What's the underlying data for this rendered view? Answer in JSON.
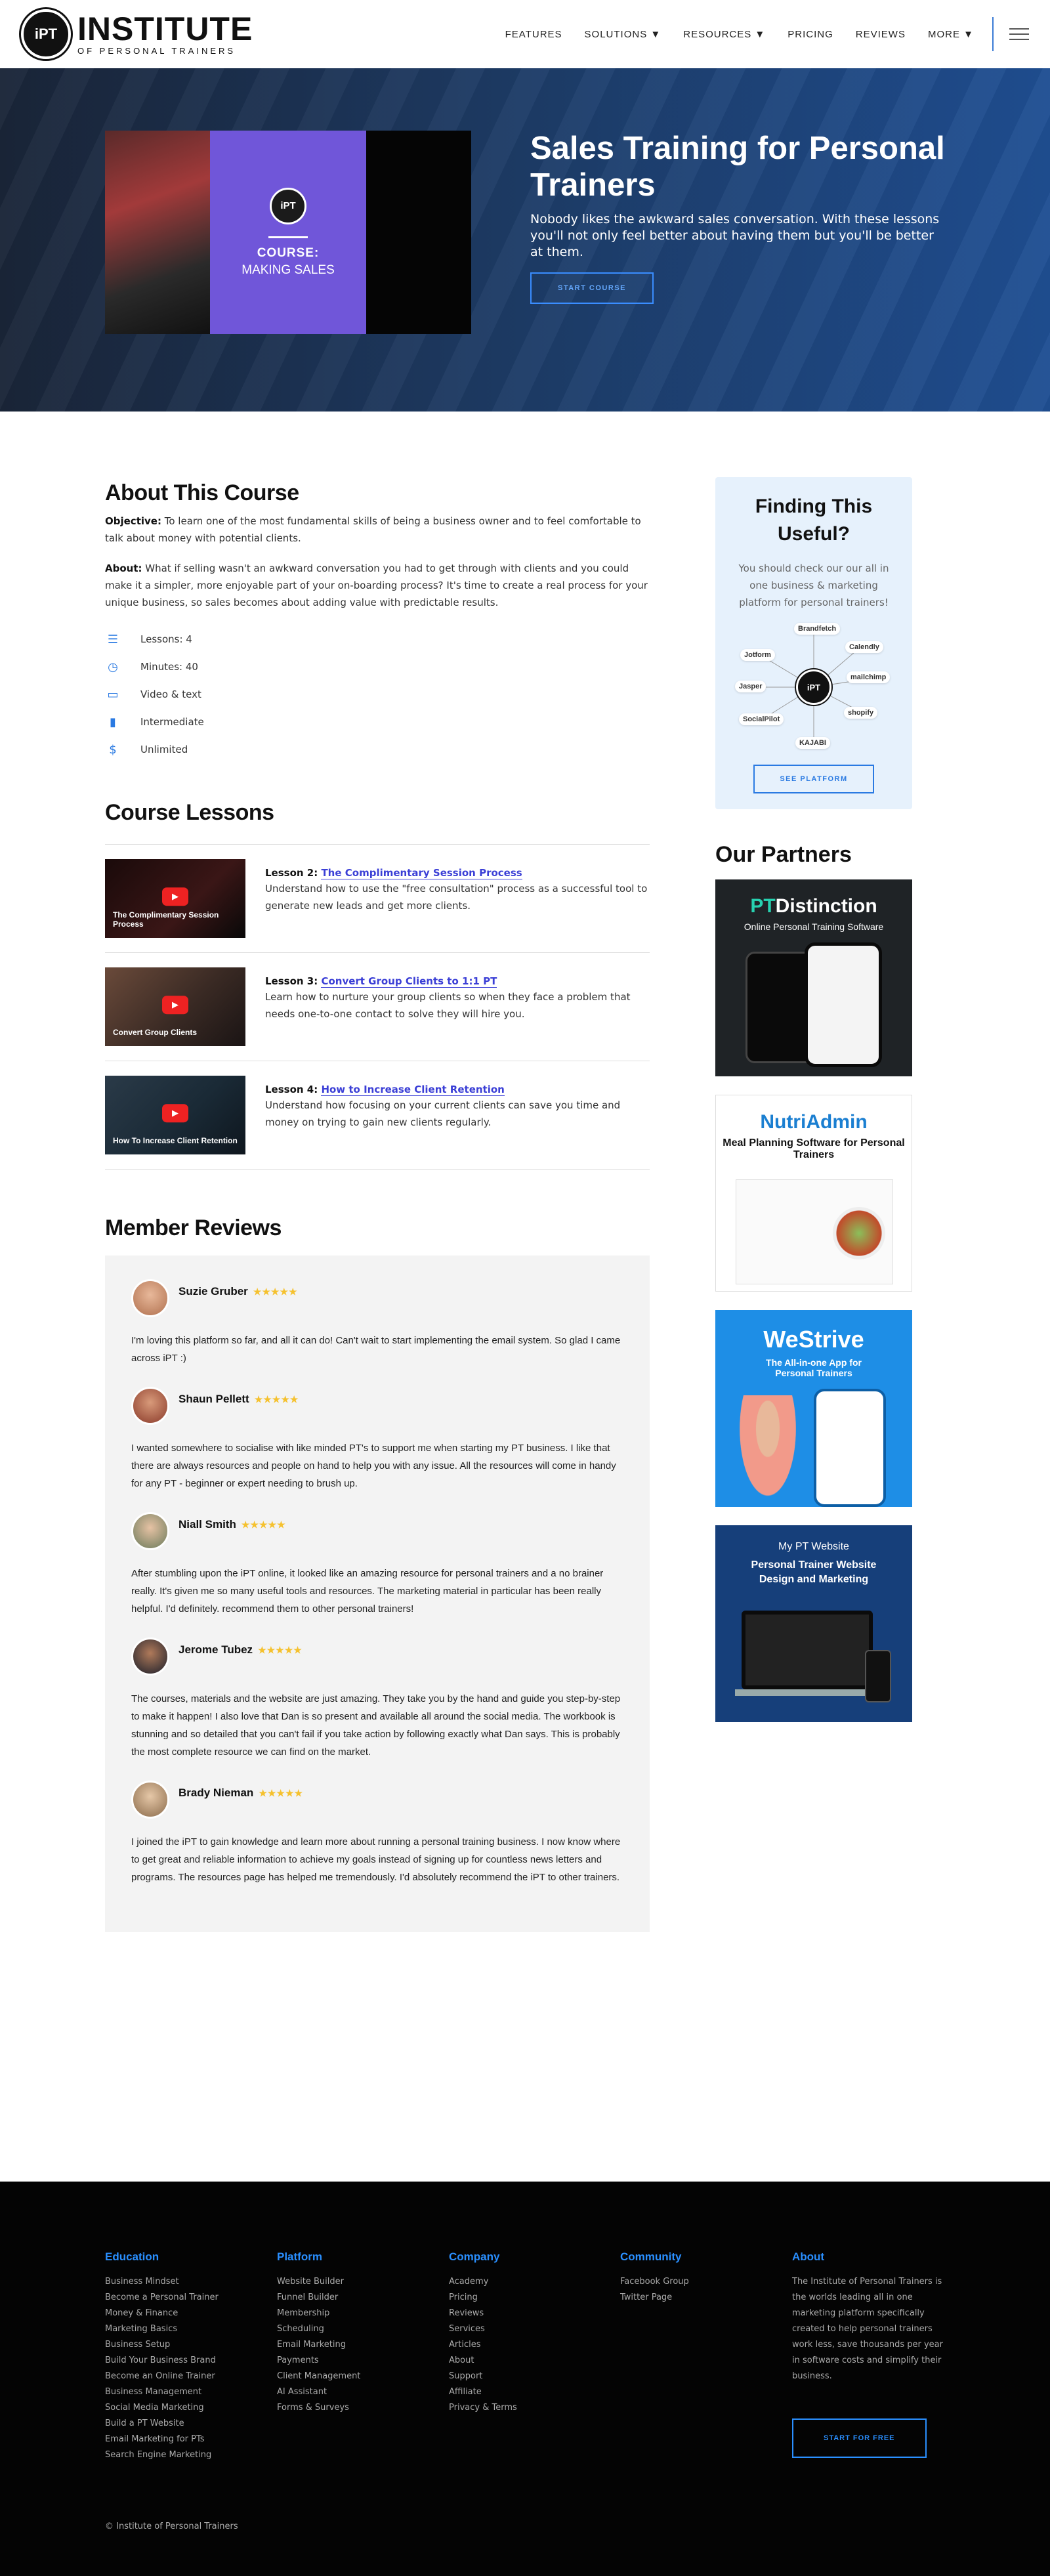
{
  "nav": {
    "logo_badge": "iPT",
    "logo_main": "INSTITUTE",
    "logo_sub": "OF PERSONAL TRAINERS",
    "links": [
      "FEATURES",
      "SOLUTIONS ▼",
      "RESOURCES ▼",
      "PRICING",
      "REVIEWS",
      "MORE ▼"
    ]
  },
  "hero": {
    "badge": "iPT",
    "course_label": "COURSE:",
    "course_name": "MAKING SALES",
    "title": "Sales Training for Personal Trainers",
    "description": "Nobody likes the awkward sales conversation. With these lessons you'll not only feel better about having them but you'll be better at them.",
    "button": "START COURSE"
  },
  "about": {
    "title": "About This Course",
    "objective_label": "Objective:",
    "objective": " To learn one of the most fundamental skills of being a business owner and to feel comfortable to talk about money with potential clients.",
    "about_label": "About:",
    "about": " What if selling wasn't an awkward conversation you had to get through with clients and you could make it a simpler, more enjoyable part of your on-boarding process? It's time to create a real process for your unique business, so sales becomes about adding value with predictable results.",
    "stats": [
      {
        "icon": "list-icon",
        "glyph": "☰",
        "label": "Lessons: 4"
      },
      {
        "icon": "clock-icon",
        "glyph": "◷",
        "label": "Minutes: 40"
      },
      {
        "icon": "video-icon",
        "glyph": "▭",
        "label": "Video & text"
      },
      {
        "icon": "level-icon",
        "glyph": "▮",
        "label": "Intermediate"
      },
      {
        "icon": "dollar-icon",
        "glyph": "$",
        "label": "Unlimited"
      }
    ]
  },
  "lessons": {
    "title": "Course Lessons",
    "items": [
      {
        "num": "Lesson 2: ",
        "title": "The Complimentary Session Process",
        "desc": "Understand how to use the \"free consultation\" process as a successful tool to generate new leads and get more clients.",
        "thumb_caption": "The Complimentary Session Process"
      },
      {
        "num": "Lesson 3: ",
        "title": "Convert Group Clients to 1:1 PT",
        "desc": "Learn how to nurture your group clients so when they face a problem that needs one-to-one contact to solve they will hire you.",
        "thumb_caption": "Convert Group Clients"
      },
      {
        "num": "Lesson 4: ",
        "title": "How to Increase Client Retention",
        "desc": "Understand how focusing on your current clients can save you time and money on trying to gain new clients regularly.",
        "thumb_caption": "How To Increase Client Retention"
      }
    ]
  },
  "reviews": {
    "title": "Member Reviews",
    "stars": "★★★★★",
    "items": [
      {
        "name": "Suzie Gruber",
        "text": "I'm loving this platform so far, and all it can do! Can't wait to start implementing the email system. So glad I came across iPT :)"
      },
      {
        "name": "Shaun Pellett",
        "text": "I wanted somewhere to socialise with like minded PT's to support me when starting my PT business. I like that there are always resources and people on hand to help you with any issue. All the resources will come in handy for any PT - beginner or expert needing to brush up."
      },
      {
        "name": "Niall Smith",
        "text": "After stumbling upon the iPT online, it looked like an amazing resource for personal trainers and a no brainer really. It's given me so many useful tools and resources. The marketing material in particular has been really helpful. I'd definitely. recommend them to other personal trainers!"
      },
      {
        "name": "Jerome Tubez",
        "text": "The courses, materials and the website are just amazing. They take you by the hand and guide you step-by-step to make it happen! I also love that Dan is so present and available all around the social media. The workbook is stunning and so detailed that you can't fail if you take action by following exactly what Dan says. This is probably the most complete resource we can find on the market."
      },
      {
        "name": "Brady Nieman",
        "text": "I joined the iPT to gain knowledge and learn more about running a personal training business. I now know where to get great and reliable information to achieve my goals instead of signing up for countless news letters and programs. The resources page has helped me tremendously. I'd absolutely recommend the iPT to other trainers."
      }
    ]
  },
  "useful": {
    "title": "Finding This Useful?",
    "text": "You should check our our all in one business & marketing platform for personal trainers!",
    "center": "iPT",
    "nodes": [
      "Brandfetch",
      "Calendly",
      "mailchimp",
      "shopify",
      "KAJABI",
      "SocialPilot",
      "Jasper",
      "Jotform"
    ],
    "button": "SEE PLATFORM"
  },
  "partners": {
    "title": "Our Partners",
    "items": [
      {
        "name_a": "PT",
        "name_b": "Distinction",
        "sub": "Online Personal Training Software"
      },
      {
        "name_a": "Nutri",
        "name_b": "Admin",
        "sub": "Meal Planning Software for Personal Trainers"
      },
      {
        "name_a": "WeStrive",
        "name_b": "",
        "sub": "The All-in-one App for Personal Trainers"
      },
      {
        "name_a": "My PT Website",
        "name_b": "",
        "sub": "Personal Trainer Website Design and Marketing"
      }
    ]
  },
  "footer": {
    "education": {
      "head": "Education",
      "links": [
        "Business Mindset",
        "Become a Personal Trainer",
        "Money & Finance",
        "Marketing Basics",
        "Business Setup",
        "Build Your Business Brand",
        "Become an Online Trainer",
        "Business Management",
        "Social Media Marketing",
        "Build a PT Website",
        "Email Marketing for PTs",
        "Search Engine Marketing"
      ]
    },
    "platform": {
      "head": "Platform",
      "links": [
        "Website Builder",
        "Funnel Builder",
        "Membership",
        "Scheduling",
        "Email Marketing",
        "Payments",
        "Client Management",
        "AI Assistant",
        "Forms & Surveys"
      ]
    },
    "company": {
      "head": "Company",
      "links": [
        "Academy",
        "Pricing",
        "Reviews",
        "Services",
        "Articles",
        "About",
        "Support",
        "Affiliate",
        "Privacy & Terms"
      ]
    },
    "community": {
      "head": "Community",
      "links": [
        "Facebook Group",
        "Twitter Page"
      ]
    },
    "about": {
      "head": "About",
      "text": "The Institute of Personal Trainers is the worlds leading all in one marketing platform specifically created to help personal trainers work less, save thousands per year in software costs and simplify their business.",
      "button": "START FOR FREE"
    },
    "copyright": "© Institute of Personal Trainers"
  }
}
